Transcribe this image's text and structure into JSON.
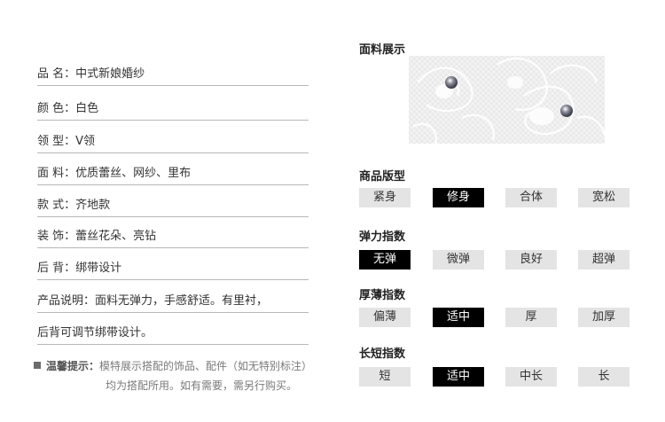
{
  "specs": [
    {
      "label": "品 名：",
      "value": "中式新娘婚纱"
    },
    {
      "label": "颜 色：",
      "value": "白色"
    },
    {
      "label": "领 型：",
      "value": "V领"
    },
    {
      "label": "面 料：",
      "value": "优质蕾丝、网纱、里布"
    },
    {
      "label": "款 式：",
      "value": "齐地款"
    },
    {
      "label": "装 饰：",
      "value": "蕾丝花朵、亮钻"
    },
    {
      "label": "后 背：",
      "value": "绑带设计"
    },
    {
      "label": "产品说明：",
      "value": "面料无弹力，手感舒适。有里衬，"
    },
    {
      "label": "",
      "value": "后背可调节绑带设计。"
    }
  ],
  "notice": {
    "title": "温馨提示：",
    "line1": "模特展示搭配的饰品、配件（如无特别标注）",
    "line2": "均为搭配所用。如有需要，需另行购买。"
  },
  "fabric": {
    "title": "面料展示"
  },
  "indices": [
    {
      "title": "商品版型",
      "options": [
        "紧身",
        "修身",
        "合体",
        "宽松"
      ],
      "selected": "修身"
    },
    {
      "title": "弹力指数",
      "options": [
        "无弹",
        "微弹",
        "良好",
        "超弹"
      ],
      "selected": "无弹"
    },
    {
      "title": "厚薄指数",
      "options": [
        "偏薄",
        "适中",
        "厚",
        "加厚"
      ],
      "selected": "适中"
    },
    {
      "title": "长短指数",
      "options": [
        "短",
        "适中",
        "中长",
        "长"
      ],
      "selected": "适中"
    }
  ],
  "colors": {
    "selected_bg": "#000000",
    "chip_bg": "#e4e4e4"
  }
}
